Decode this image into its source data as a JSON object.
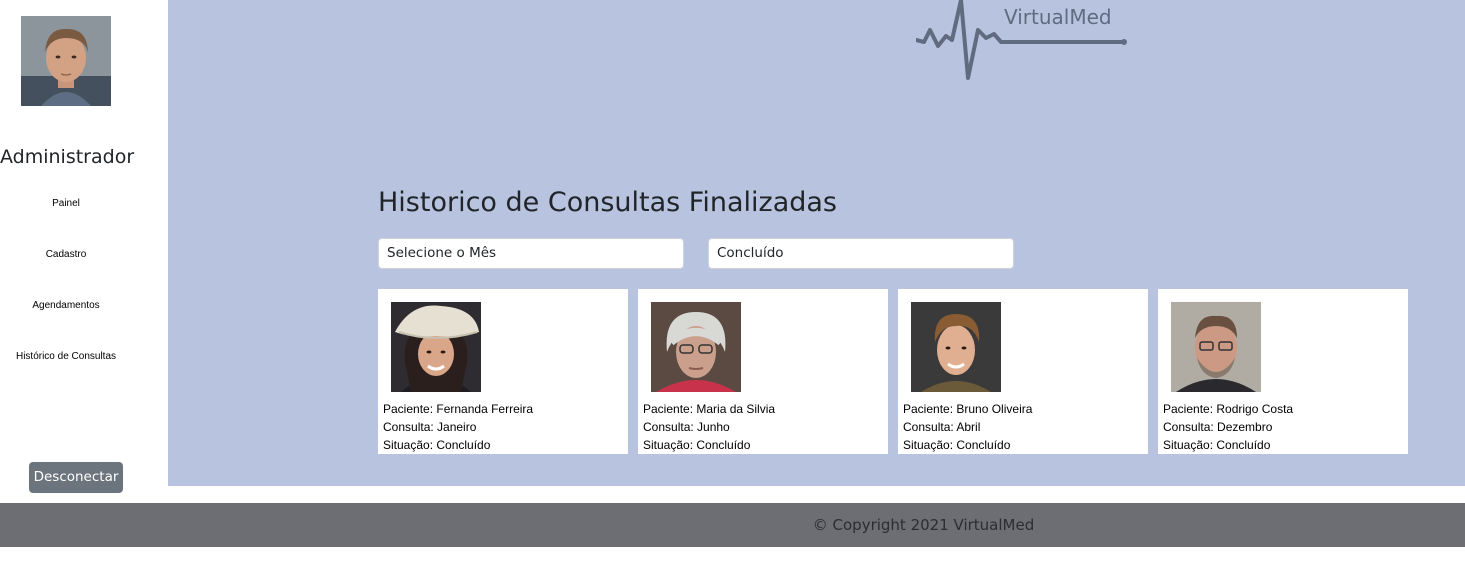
{
  "sidebar": {
    "role": "Administrador",
    "items": [
      {
        "label": "Painel"
      },
      {
        "label": "Cadastro"
      },
      {
        "label": "Agendamentos"
      },
      {
        "label": "Histórico de Consultas"
      }
    ],
    "logout_label": "Desconectar"
  },
  "header": {
    "logo_text": "VirtualMed"
  },
  "main": {
    "title": "Historico de Consultas Finalizadas",
    "filters": {
      "month": "Selecione o Mês",
      "status": "Concluído"
    },
    "cards": [
      {
        "patient": "Paciente: Fernanda Ferreira",
        "consult": "Consulta: Janeiro",
        "status": "Situação: Concluído"
      },
      {
        "patient": "Paciente: Maria da Silvia",
        "consult": "Consulta: Junho",
        "status": "Situação: Concluído"
      },
      {
        "patient": "Paciente: Bruno Oliveira",
        "consult": "Consulta: Abril",
        "status": "Situação: Concluído"
      },
      {
        "patient": "Paciente: Rodrigo Costa",
        "consult": "Consulta: Dezembro",
        "status": "Situação: Concluído"
      }
    ]
  },
  "footer": {
    "copyright": "© Copyright 2021 VirtualMed"
  },
  "colors": {
    "main_bg": "#b8c4df",
    "footer_bg": "#6c6e74",
    "logout_bg": "#6c757d"
  }
}
